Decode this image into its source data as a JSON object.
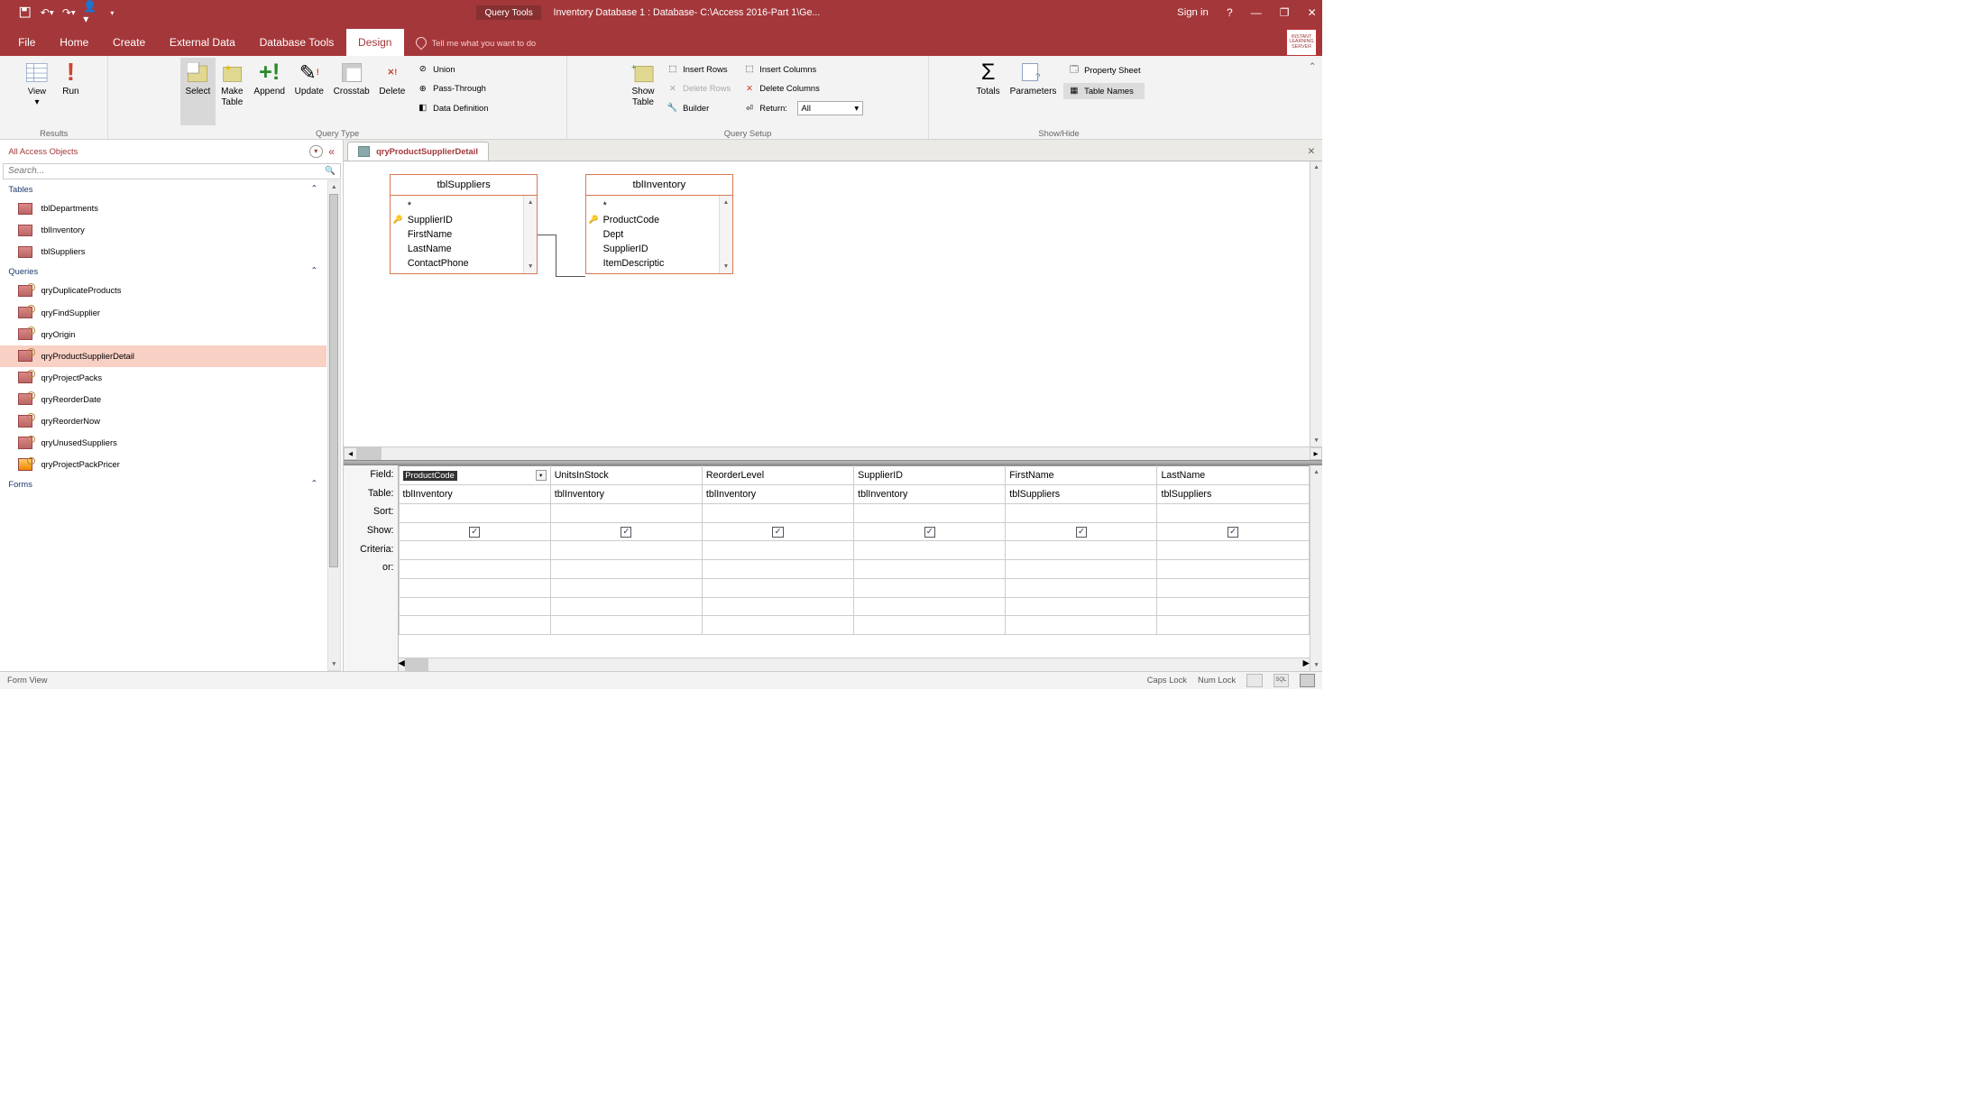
{
  "titlebar": {
    "tools_context": "Query Tools",
    "title": "Inventory Database 1 : Database- C:\\Access 2016-Part 1\\Ge...",
    "signin": "Sign in"
  },
  "tabs": {
    "file": "File",
    "home": "Home",
    "create": "Create",
    "external": "External Data",
    "dbtools": "Database Tools",
    "design": "Design",
    "tellme": "Tell me what you want to do"
  },
  "ribbon": {
    "results": {
      "label": "Results",
      "view": "View",
      "run": "Run"
    },
    "querytype": {
      "label": "Query Type",
      "select": "Select",
      "maketable": "Make\nTable",
      "append": "Append",
      "update": "Update",
      "crosstab": "Crosstab",
      "delete": "Delete",
      "union": "Union",
      "passthrough": "Pass-Through",
      "datadef": "Data Definition"
    },
    "setup": {
      "label": "Query Setup",
      "showtable": "Show\nTable",
      "insertrows": "Insert Rows",
      "deleterows": "Delete Rows",
      "builder": "Builder",
      "insertcols": "Insert Columns",
      "deletecols": "Delete Columns",
      "return": "Return:",
      "return_val": "All"
    },
    "showhide": {
      "label": "Show/Hide",
      "totals": "Totals",
      "parameters": "Parameters",
      "propsheet": "Property Sheet",
      "tablenames": "Table Names"
    }
  },
  "nav": {
    "header": "All Access Objects",
    "search_ph": "Search...",
    "groups": {
      "tables": "Tables",
      "queries": "Queries",
      "forms": "Forms"
    },
    "tables": [
      "tblDepartments",
      "tblInventory",
      "tblSuppliers"
    ],
    "queries": [
      "qryDuplicateProducts",
      "qryFindSupplier",
      "qryOrigin",
      "qryProductSupplierDetail",
      "qryProjectPacks",
      "qryReorderDate",
      "qryReorderNow",
      "qryUnusedSuppliers",
      "qryProjectPackPricer"
    ],
    "selected": "qryProductSupplierDetail"
  },
  "doc": {
    "tab": "qryProductSupplierDetail",
    "tables": {
      "suppliers": {
        "title": "tblSuppliers",
        "fields": [
          "*",
          "SupplierID",
          "FirstName",
          "LastName",
          "ContactPhone"
        ],
        "key": "SupplierID"
      },
      "inventory": {
        "title": "tblInventory",
        "fields": [
          "*",
          "ProductCode",
          "Dept",
          "SupplierID",
          "ItemDescriptic"
        ],
        "key": "ProductCode"
      }
    }
  },
  "grid": {
    "labels": {
      "field": "Field:",
      "table": "Table:",
      "sort": "Sort:",
      "show": "Show:",
      "criteria": "Criteria:",
      "or": "or:"
    },
    "cols": [
      {
        "field": "ProductCode",
        "table": "tblInventory",
        "show": true,
        "selected": true
      },
      {
        "field": "UnitsInStock",
        "table": "tblInventory",
        "show": true
      },
      {
        "field": "ReorderLevel",
        "table": "tblInventory",
        "show": true
      },
      {
        "field": "SupplierID",
        "table": "tblInventory",
        "show": true
      },
      {
        "field": "FirstName",
        "table": "tblSuppliers",
        "show": true
      },
      {
        "field": "LastName",
        "table": "tblSuppliers",
        "show": true
      }
    ]
  },
  "status": {
    "left": "Form View",
    "caps": "Caps Lock",
    "num": "Num Lock"
  },
  "logo": "INSTANT LEARNING SERVER"
}
